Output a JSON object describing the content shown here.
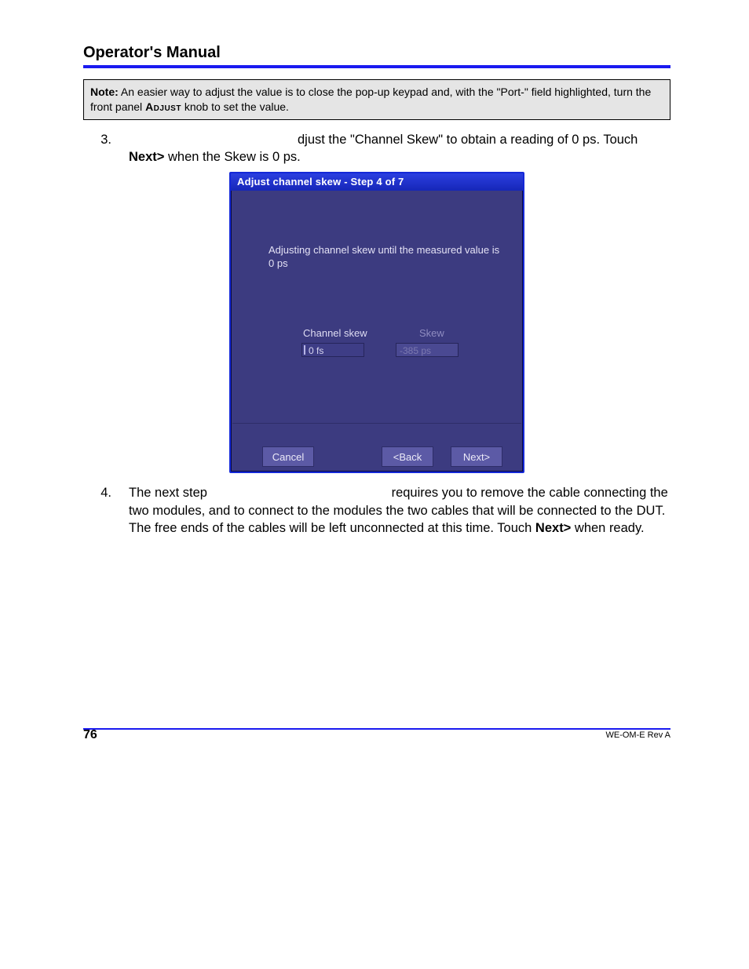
{
  "header": {
    "title": "Operator's Manual"
  },
  "note": {
    "prefix": "Note:",
    "text_before": " An easier way to adjust the value is to close the pop-up keypad and, with the \"Port-\" field highlighted, turn the front panel ",
    "adjust": "Adjust",
    "text_after": " knob to set the value."
  },
  "step3": {
    "number": "3.",
    "line1_after_gap": "djust the \"Channel Skew\" to obtain a reading of 0 ps. Touch ",
    "bold1": "Next>",
    "line2_rest": " when the Skew is 0 ps."
  },
  "wizard": {
    "title": "Adjust channel skew - Step 4 of 7",
    "instruction": "Adjusting channel skew until the measured value is 0 ps",
    "channel_label": "Channel skew",
    "channel_value": "0 fs",
    "skew_label": "Skew",
    "skew_value": "-385 ps",
    "buttons": {
      "cancel": "Cancel",
      "back": "<Back",
      "next": "Next>"
    }
  },
  "step4": {
    "number": "4.",
    "lead": "The next step",
    "after_gap": " requires you to remove the cable connecting the two modules, and to connect to the modules the two cables that will be connected to the DUT. The free ends of the cables will be left unconnected at this time. Touch ",
    "bold": "Next>",
    "tail": " when ready."
  },
  "footer": {
    "page": "76",
    "rev": "WE-OM-E Rev A"
  }
}
